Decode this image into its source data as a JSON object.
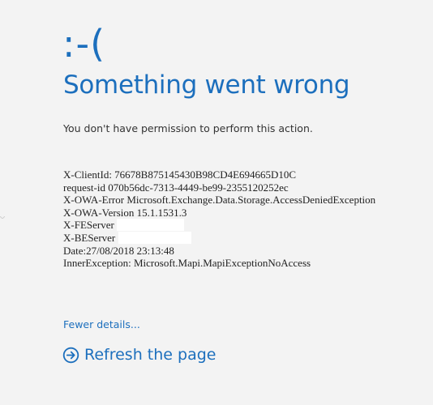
{
  "error_page": {
    "emoticon": ":-(",
    "title": "Something went wrong",
    "message": "You don't have permission to perform this action.",
    "details": {
      "client_id": "X-ClientId: 76678B875145430B98CD4E694665D10C",
      "request_id": "request-id 070b56dc-7313-4449-be99-2355120252ec",
      "owa_error": "X-OWA-Error Microsoft.Exchange.Data.Storage.AccessDeniedException",
      "owa_version": "X-OWA-Version 15.1.1531.3",
      "fe_server": "X-FEServer",
      "be_server": "X-BEServer",
      "date": "Date:27/08/2018 23:13:48",
      "inner_exception": "InnerException: Microsoft.Mapi.MapiExceptionNoAccess"
    },
    "fewer_details_link": "Fewer details...",
    "refresh_link": "Refresh the page"
  },
  "colors": {
    "accent": "#1c6fbd",
    "background": "#f3f3f3",
    "body_text": "#333333"
  },
  "icons": {
    "refresh": "circle-arrow-right-icon"
  }
}
